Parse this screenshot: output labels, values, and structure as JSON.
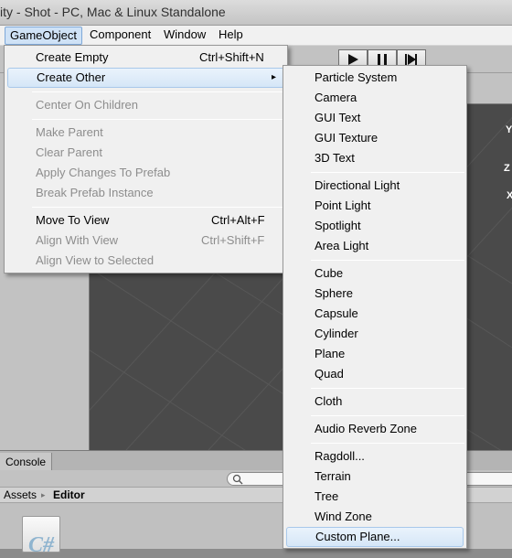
{
  "window": {
    "title": "ity - Shot - PC, Mac & Linux Standalone"
  },
  "menubar": {
    "items": [
      {
        "label": "GameObject"
      },
      {
        "label": "Component"
      },
      {
        "label": "Window"
      },
      {
        "label": "Help"
      }
    ]
  },
  "gameobject_menu": {
    "items": [
      {
        "label": "Create Empty",
        "shortcut": "Ctrl+Shift+N",
        "enabled": true
      },
      {
        "label": "Create Other",
        "shortcut": "",
        "submenu_arrow": "▸",
        "enabled": true,
        "highlighted": true
      },
      {
        "label": "Center On Children",
        "shortcut": "",
        "enabled": false
      },
      {
        "label": "Make Parent",
        "shortcut": "",
        "enabled": false
      },
      {
        "label": "Clear Parent",
        "shortcut": "",
        "enabled": false
      },
      {
        "label": "Apply Changes To Prefab",
        "shortcut": "",
        "enabled": false
      },
      {
        "label": "Break Prefab Instance",
        "shortcut": "",
        "enabled": false
      },
      {
        "label": "Move To View",
        "shortcut": "Ctrl+Alt+F",
        "enabled": true
      },
      {
        "label": "Align With View",
        "shortcut": "Ctrl+Shift+F",
        "enabled": false
      },
      {
        "label": "Align View to Selected",
        "shortcut": "",
        "enabled": false
      }
    ]
  },
  "create_other_menu": {
    "items": [
      {
        "label": "Particle System"
      },
      {
        "label": "Camera"
      },
      {
        "label": "GUI Text"
      },
      {
        "label": "GUI Texture"
      },
      {
        "label": "3D Text"
      },
      {
        "label": "Directional Light"
      },
      {
        "label": "Point Light"
      },
      {
        "label": "Spotlight"
      },
      {
        "label": "Area Light"
      },
      {
        "label": "Cube"
      },
      {
        "label": "Sphere"
      },
      {
        "label": "Capsule"
      },
      {
        "label": "Cylinder"
      },
      {
        "label": "Plane"
      },
      {
        "label": "Quad"
      },
      {
        "label": "Cloth"
      },
      {
        "label": "Audio Reverb Zone"
      },
      {
        "label": "Ragdoll..."
      },
      {
        "label": "Terrain"
      },
      {
        "label": "Tree"
      },
      {
        "label": "Wind Zone"
      },
      {
        "label": "Custom Plane...",
        "highlighted": true
      }
    ]
  },
  "toolbar": {
    "play_icon": "play-icon",
    "pause_icon": "pause-icon",
    "step_icon": "step-icon"
  },
  "scene": {
    "axis_labels": [
      "Y",
      "Z",
      "X"
    ]
  },
  "console": {
    "tab_label": "Console"
  },
  "project": {
    "breadcrumb": [
      {
        "label": "Assets"
      },
      {
        "label": "Editor"
      }
    ],
    "breadcrumb_sep": "▸",
    "file_icon_glyph": "C#"
  },
  "colors": {
    "menu_bg": "#f0f0f0",
    "highlight_border": "#a8c8ea",
    "disabled_text": "#8d8d8d",
    "scene_bg": "#4a4a4a"
  }
}
